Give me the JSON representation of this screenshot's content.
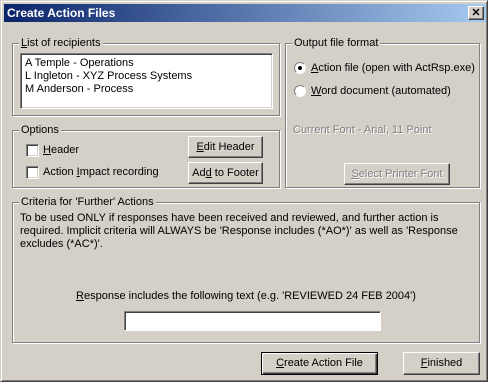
{
  "window": {
    "title": "Create Action Files",
    "close_glyph": "✕"
  },
  "recipients": {
    "legend_key": "L",
    "legend_rest": "ist of recipients",
    "items": [
      "A Temple - Operations",
      "L Ingleton - XYZ Process Systems",
      "M Anderson - Process"
    ]
  },
  "options": {
    "legend": "Options",
    "header_key": "H",
    "header_rest": "eader",
    "header_checked": false,
    "impact_pre": "Action ",
    "impact_key": "I",
    "impact_rest": "mpact recording",
    "impact_checked": false,
    "edit_header_key": "E",
    "edit_header_rest": "dit Header",
    "add_footer_pre": "Ad",
    "add_footer_key": "d",
    "add_footer_rest": " to Footer"
  },
  "output": {
    "legend": "Output file format",
    "action_file_key": "A",
    "action_file_rest": "ction file (open with ActRsp.exe)",
    "action_file_selected": true,
    "word_key": "W",
    "word_rest": "ord document (automated)",
    "word_selected": false,
    "current_font": "Current Font - Arial, 11 Point",
    "select_font_key": "S",
    "select_font_rest": "elect Printer Font"
  },
  "criteria": {
    "legend": "Criteria for 'Further' Actions",
    "description": "To be used ONLY if responses have been received and reviewed, and further action is required. Implicit criteria will ALWAYS be 'Response includes (*AO*)' as well as 'Response excludes (*AC*)'.",
    "response_key": "R",
    "response_rest": "esponse includes the following text (e.g. 'REVIEWED 24 FEB 2004')",
    "response_value": ""
  },
  "footer": {
    "create_key": "C",
    "create_rest": "reate Action File",
    "finished_key": "F",
    "finished_rest": "inished"
  }
}
